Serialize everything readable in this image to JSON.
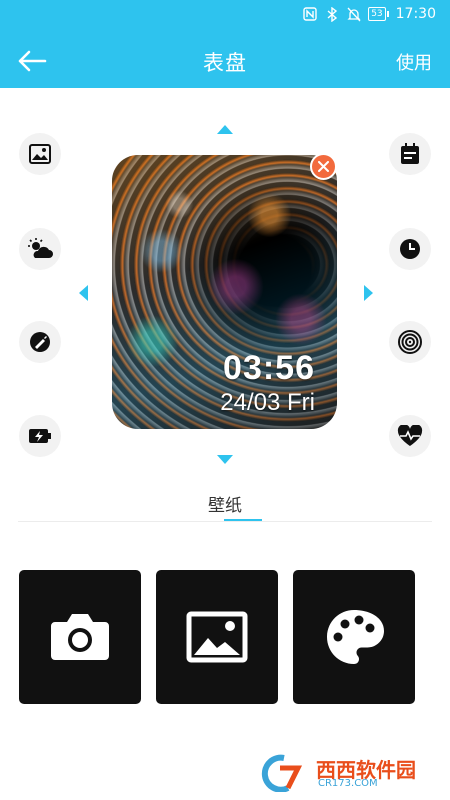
{
  "status_bar": {
    "battery": "53",
    "time": "17:30",
    "icons": [
      "nfc-icon",
      "bluetooth-icon",
      "mute-icon",
      "battery-icon"
    ]
  },
  "header": {
    "back_icon": "arrow-left-icon",
    "title": "表盘",
    "action_label": "使用"
  },
  "editor": {
    "left_buttons": [
      "image-icon",
      "weather-icon",
      "brush-icon",
      "battery-charging-icon"
    ],
    "right_buttons": [
      "calendar-icon",
      "clock-icon",
      "target-icon",
      "heart-rate-icon"
    ],
    "arrows": [
      "up",
      "down",
      "left",
      "right"
    ]
  },
  "watch_face": {
    "time": "03:56",
    "date": "24/03 Fri"
  },
  "tab": {
    "label": "壁纸"
  },
  "wallpaper_options": [
    "camera-icon",
    "gallery-icon",
    "palette-icon"
  ],
  "watermark": {
    "brand": "西西软件园",
    "domain": "CR173.COM"
  },
  "colors": {
    "accent": "#2ec3ee",
    "remove": "#f26a3d",
    "tile": "#111111"
  }
}
